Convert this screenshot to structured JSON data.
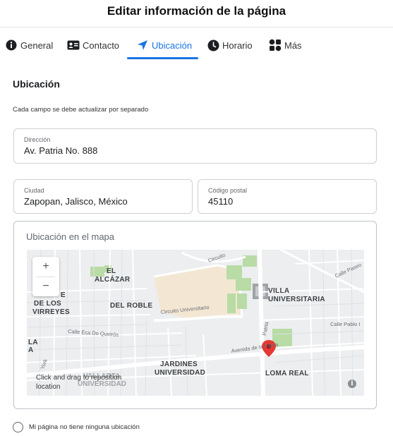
{
  "header": {
    "title": "Editar información de la página"
  },
  "tabs": [
    {
      "label": "General",
      "icon": "info-icon"
    },
    {
      "label": "Contacto",
      "icon": "contact-card-icon"
    },
    {
      "label": "Ubicación",
      "icon": "location-arrow-icon"
    },
    {
      "label": "Horario",
      "icon": "clock-icon"
    },
    {
      "label": "Más",
      "icon": "grid-more-icon"
    }
  ],
  "active_tab": "Ubicación",
  "accent_color": "#1b74e4",
  "section": {
    "title": "Ubicación",
    "note": "Cada campo se debe actualizar por separado"
  },
  "fields": {
    "address": {
      "label": "Dirección",
      "value": "Av. Patria No. 888"
    },
    "city": {
      "label": "Ciudad",
      "value": "Zapopan, Jalisco, México"
    },
    "postal": {
      "label": "Código postal",
      "value": "45110"
    }
  },
  "map": {
    "label": "Ubicación en el mapa",
    "zoom_in": "+",
    "zoom_out": "−",
    "hint": "Click and drag to reposition location",
    "info": "i",
    "pin_color": "#e53935",
    "place_labels": {
      "el_alcazar_1": "EL",
      "el_alcazar_2": "ALCÁZAR",
      "virreyes_0": "E",
      "virreyes_1": "DE LOS",
      "virreyes_2": "VIRREYES",
      "del_roble": "DEL ROBLE",
      "villa_1": "VILLA",
      "villa_2": "UNIVERSITARIA",
      "jardines_1": "JARDINES",
      "jardines_2": "UNIVERSIDAD",
      "loma_real": "LOMA REAL",
      "vallarta_1": "VALLARTA",
      "vallarta_2": "UNIVERSIDAD",
      "la_1": "LA",
      "la_2": "A"
    },
    "street_labels": {
      "circuito": "Circuito",
      "circuito_universitario": "Circuito Universitario",
      "calle_eca": "Calle Eca Do Queirós",
      "avenida_patria": "Avenida de la Patria",
      "patria_v": "Patria",
      "calle_paseo": "Calle Paseo",
      "calle_pablo": "Calle Pablo I",
      "york": "York"
    }
  },
  "no_location": {
    "label": "Mi página no tiene ninguna ubicación"
  }
}
